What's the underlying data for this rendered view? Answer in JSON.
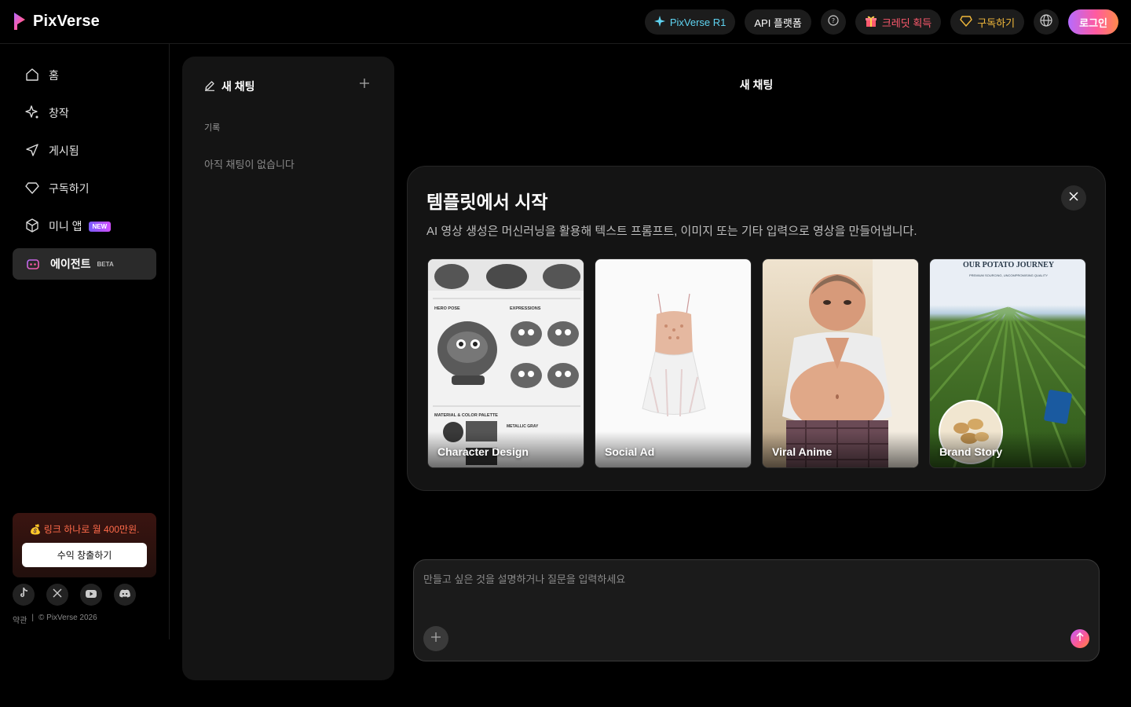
{
  "brand": {
    "name": "PixVerse"
  },
  "topbar": {
    "r1_label": "PixVerse R1",
    "api_label": "API 플랫폼",
    "credit_label": "크레딧 획득",
    "subscribe_label": "구독하기",
    "login_label": "로그인"
  },
  "sidebar": {
    "items": [
      {
        "label": "홈",
        "icon": "home-icon"
      },
      {
        "label": "창작",
        "icon": "sparkle-icon"
      },
      {
        "label": "게시됨",
        "icon": "send-icon"
      },
      {
        "label": "구독하기",
        "icon": "diamond-icon"
      },
      {
        "label": "미니 앱",
        "icon": "cube-icon",
        "badge": "NEW"
      },
      {
        "label": "에이전트",
        "icon": "robot-icon",
        "badge": "BETA"
      }
    ],
    "promo_text": "💰 링크 하나로 월 400만원.",
    "promo_button": "수익 창출하기",
    "footer_terms": "약관",
    "footer_copyright": "© PixVerse 2026"
  },
  "chatlist": {
    "new_chat": "새 채팅",
    "history_label": "기록",
    "empty": "아직 채팅이 없습니다"
  },
  "main": {
    "title": "새 채팅",
    "templates": {
      "title": "템플릿에서 시작",
      "description": "AI 영상 생성은 머신러닝을 활용해 텍스트 프롬프트, 이미지 또는 기타 입력으로 영상을 만들어냅니다.",
      "items": [
        {
          "label": "Character Design"
        },
        {
          "label": "Social Ad"
        },
        {
          "label": "Viral Anime"
        },
        {
          "label": "Brand Story"
        }
      ],
      "char_heading_hero": "HERO POSE",
      "char_heading_expr": "EXPRESSIONS",
      "char_heading_mat": "MATERIAL & COLOR PALETTE",
      "char_metal": "METALLIC GRAY",
      "brand_heading": "OUR POTATO JOURNEY",
      "brand_sub": "PREMIUM SOURCING, UNCOMPROMISING QUALITY"
    },
    "composer": {
      "placeholder": "만들고 싶은 것을 설명하거나 질문을 입력하세요"
    }
  },
  "colors": {
    "accent_r1": "#5fd4f2",
    "accent_gift": "#ff5a6e",
    "accent_subscribe": "#f2b93b",
    "promo_text": "#ff6a4a"
  }
}
